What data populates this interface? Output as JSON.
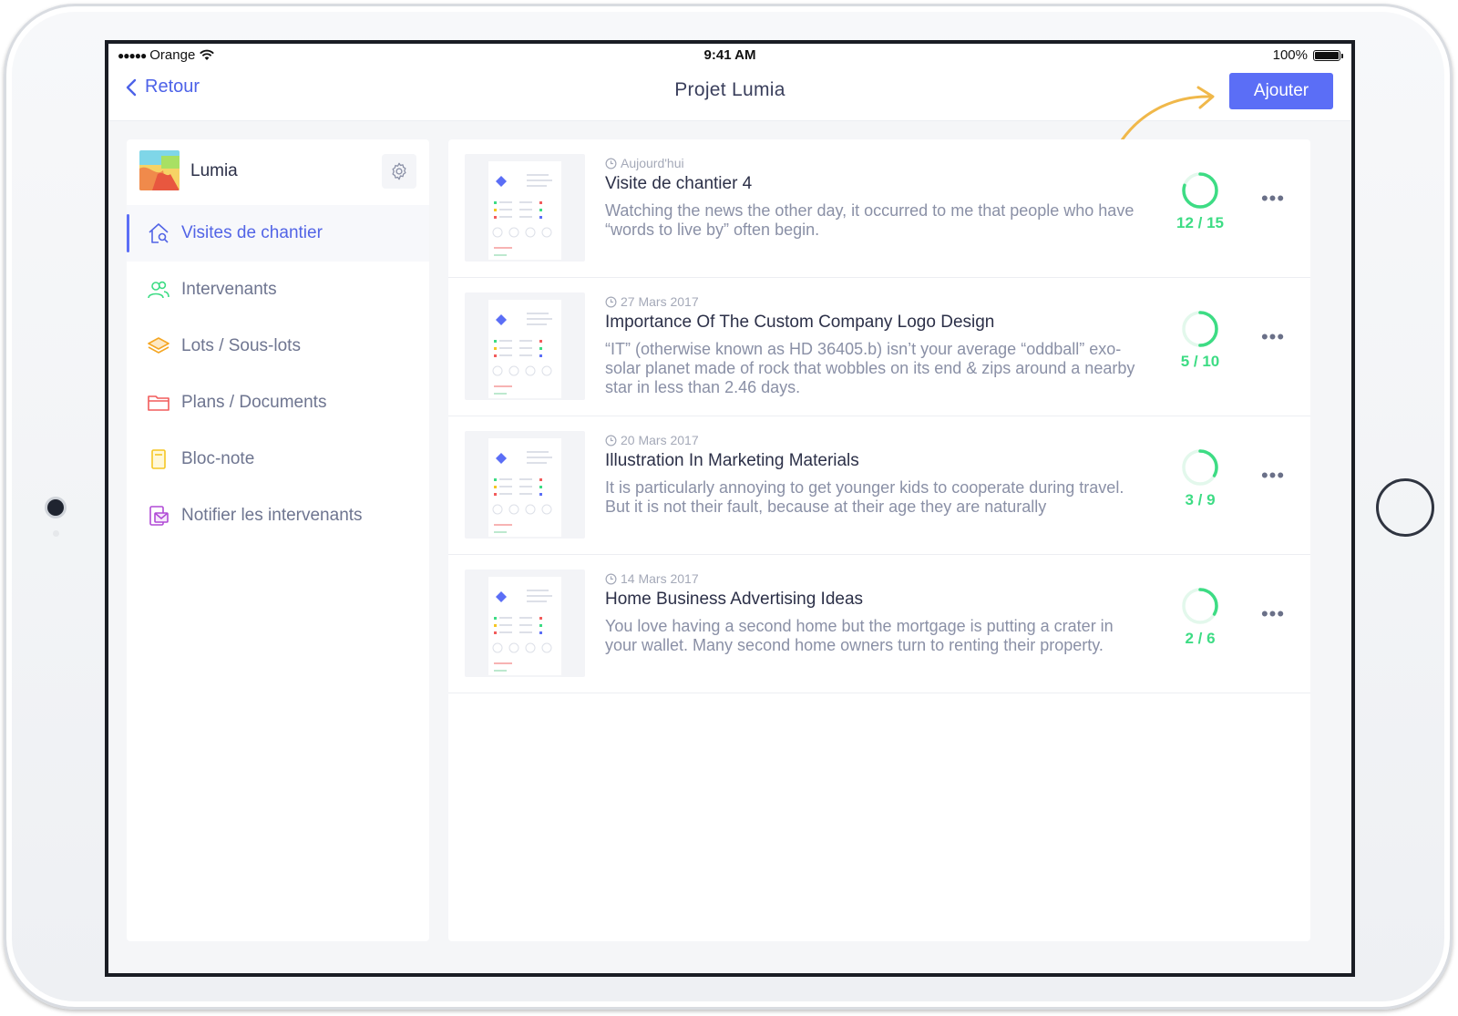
{
  "status_bar": {
    "carrier": "Orange",
    "time": "9:41 AM",
    "battery": "100%"
  },
  "nav": {
    "back_label": "Retour",
    "title": "Projet Lumia",
    "add_label": "Ajouter"
  },
  "project": {
    "name": "Lumia"
  },
  "sidebar": {
    "items": [
      {
        "label": "Visites de chantier",
        "icon": "home-search-icon",
        "color": "#5264e6",
        "active": true
      },
      {
        "label": "Intervenants",
        "icon": "users-icon",
        "color": "#3ddc84",
        "active": false
      },
      {
        "label": "Lots / Sous-lots",
        "icon": "layers-icon",
        "color": "#f5a623",
        "active": false
      },
      {
        "label": "Plans / Documents",
        "icon": "folder-icon",
        "color": "#f25c5c",
        "active": false
      },
      {
        "label": "Bloc-note",
        "icon": "notepad-icon",
        "color": "#f5c623",
        "active": false
      },
      {
        "label": "Notifier les intervenants",
        "icon": "mail-notify-icon",
        "color": "#b04ad6",
        "active": false
      }
    ]
  },
  "visits": [
    {
      "date": "Aujourd'hui",
      "title": "Visite de chantier 4",
      "description": "Watching the news the other day, it occurred to me that people who have “words to live by” often begin.",
      "progress_label": "12 / 15",
      "done": 12,
      "total": 15
    },
    {
      "date": "27 Mars 2017",
      "title": "Importance Of The Custom Company Logo Design",
      "description": "“IT” (otherwise known as HD 36405.b) isn’t your average “oddball” exo-solar planet made of rock that wobbles on its end & zips around a nearby star in less than 2.46 days.",
      "progress_label": "5 / 10",
      "done": 5,
      "total": 10
    },
    {
      "date": "20 Mars 2017",
      "title": "Illustration In Marketing Materials",
      "description": "It is particularly annoying to get younger kids to cooperate during travel. But it is not their fault, because at their age they are naturally",
      "progress_label": "3 / 9",
      "done": 3,
      "total": 9
    },
    {
      "date": "14 Mars 2017",
      "title": "Home Business Advertising Ideas",
      "description": "You love having a second home but the mortgage is putting a crater in your wallet. Many second home owners turn to renting their property.",
      "progress_label": "2 / 6",
      "done": 2,
      "total": 6
    }
  ],
  "colors": {
    "accent": "#5b6ef6",
    "progress": "#3ddc84",
    "annotation_arrow": "#f0b84a"
  }
}
